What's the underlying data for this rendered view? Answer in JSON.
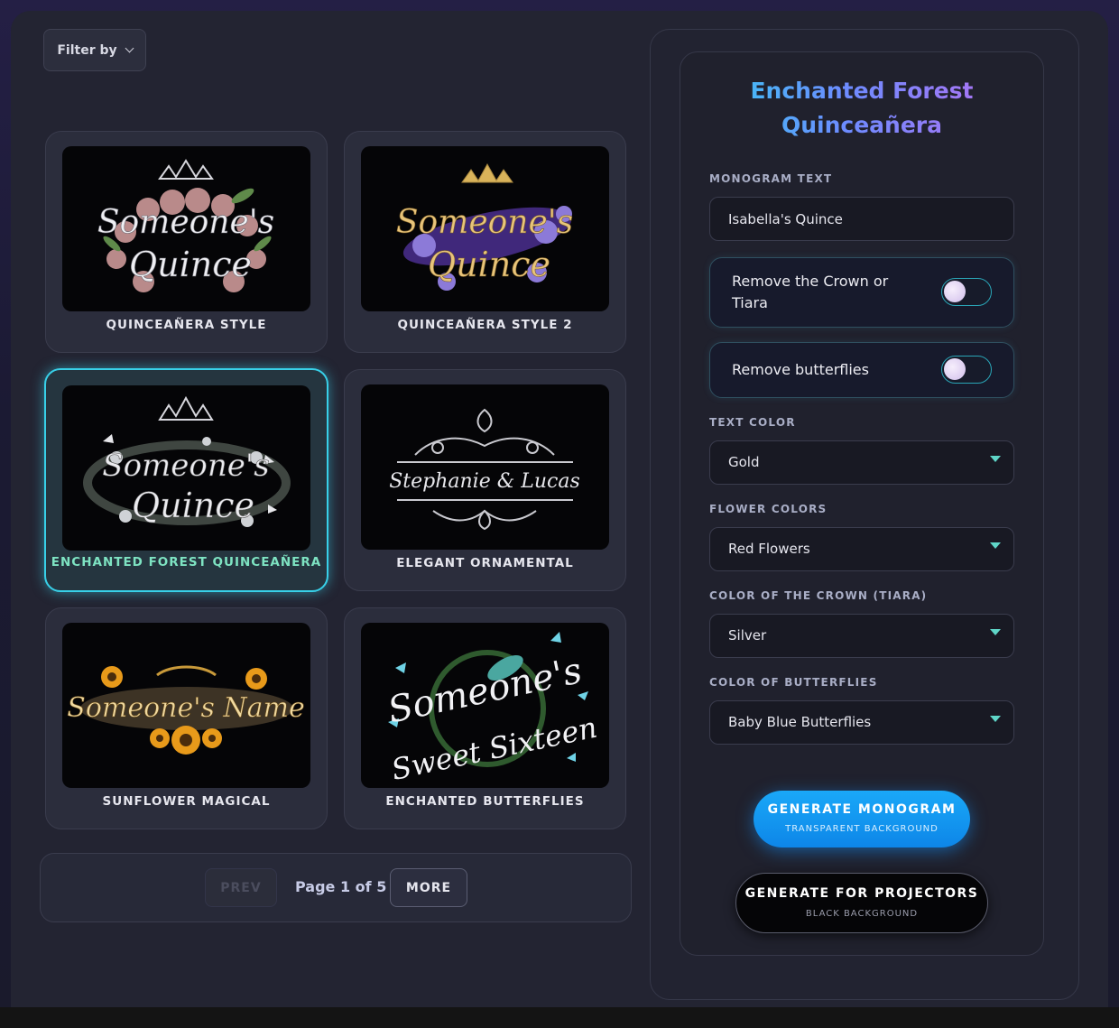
{
  "filter": {
    "label": "Filter by"
  },
  "gallery": {
    "cards": [
      {
        "label": "QUINCEAÑERA STYLE",
        "preview": [
          "Someone's",
          "Quince"
        ]
      },
      {
        "label": "QUINCEAÑERA STYLE 2",
        "preview": [
          "Someone's",
          "Quince"
        ]
      },
      {
        "label": "ENCHANTED FOREST QUINCEAÑERA",
        "preview": [
          "Someone's",
          "Quince"
        ],
        "selected": true
      },
      {
        "label": "ELEGANT ORNAMENTAL",
        "preview": [
          "Stephanie & Lucas"
        ]
      },
      {
        "label": "SUNFLOWER MAGICAL",
        "preview": [
          "Someone's Name"
        ]
      },
      {
        "label": "ENCHANTED BUTTERFLIES",
        "preview": [
          "Someone's",
          "Sweet Sixteen"
        ]
      }
    ]
  },
  "pager": {
    "prev_label": "PREV",
    "page_info": "Page 1 of 5",
    "more_label": "MORE",
    "current_page": 1,
    "total_pages": 5
  },
  "panel": {
    "title_line1": "Enchanted Forest",
    "title_line2": "Quinceañera",
    "monogram_label": "MONOGRAM TEXT",
    "monogram_value": "Isabella's Quince",
    "toggle_crown_label": "Remove the Crown or Tiara",
    "toggle_crown_on": false,
    "toggle_butterflies_label": "Remove butterflies",
    "toggle_butterflies_on": false,
    "text_color_label": "TEXT COLOR",
    "text_color_value": "Gold",
    "flower_colors_label": "FLOWER COLORS",
    "flower_colors_value": "Red Flowers",
    "crown_color_label": "COLOR OF THE CROWN (TIARA)",
    "crown_color_value": "Silver",
    "butterfly_color_label": "COLOR OF BUTTERFLIES",
    "butterfly_color_value": "Baby Blue Butterflies",
    "generate_label": "GENERATE MONOGRAM",
    "generate_sub": "TRANSPARENT BACKGROUND",
    "projector_label": "GENERATE FOR PROJECTORS",
    "projector_sub": "BLACK BACKGROUND"
  },
  "colors": {
    "accent_cyan": "#38d0e8",
    "selected_label": "#7ee3c2",
    "generate_button": "#1aa8f8",
    "title_gradient": [
      "#2fd4f0",
      "#6c8cff",
      "#c06cf0"
    ]
  },
  "icons": {
    "filter_chevron": "chevron-down-icon",
    "select_caret": "caret-down-icon"
  }
}
